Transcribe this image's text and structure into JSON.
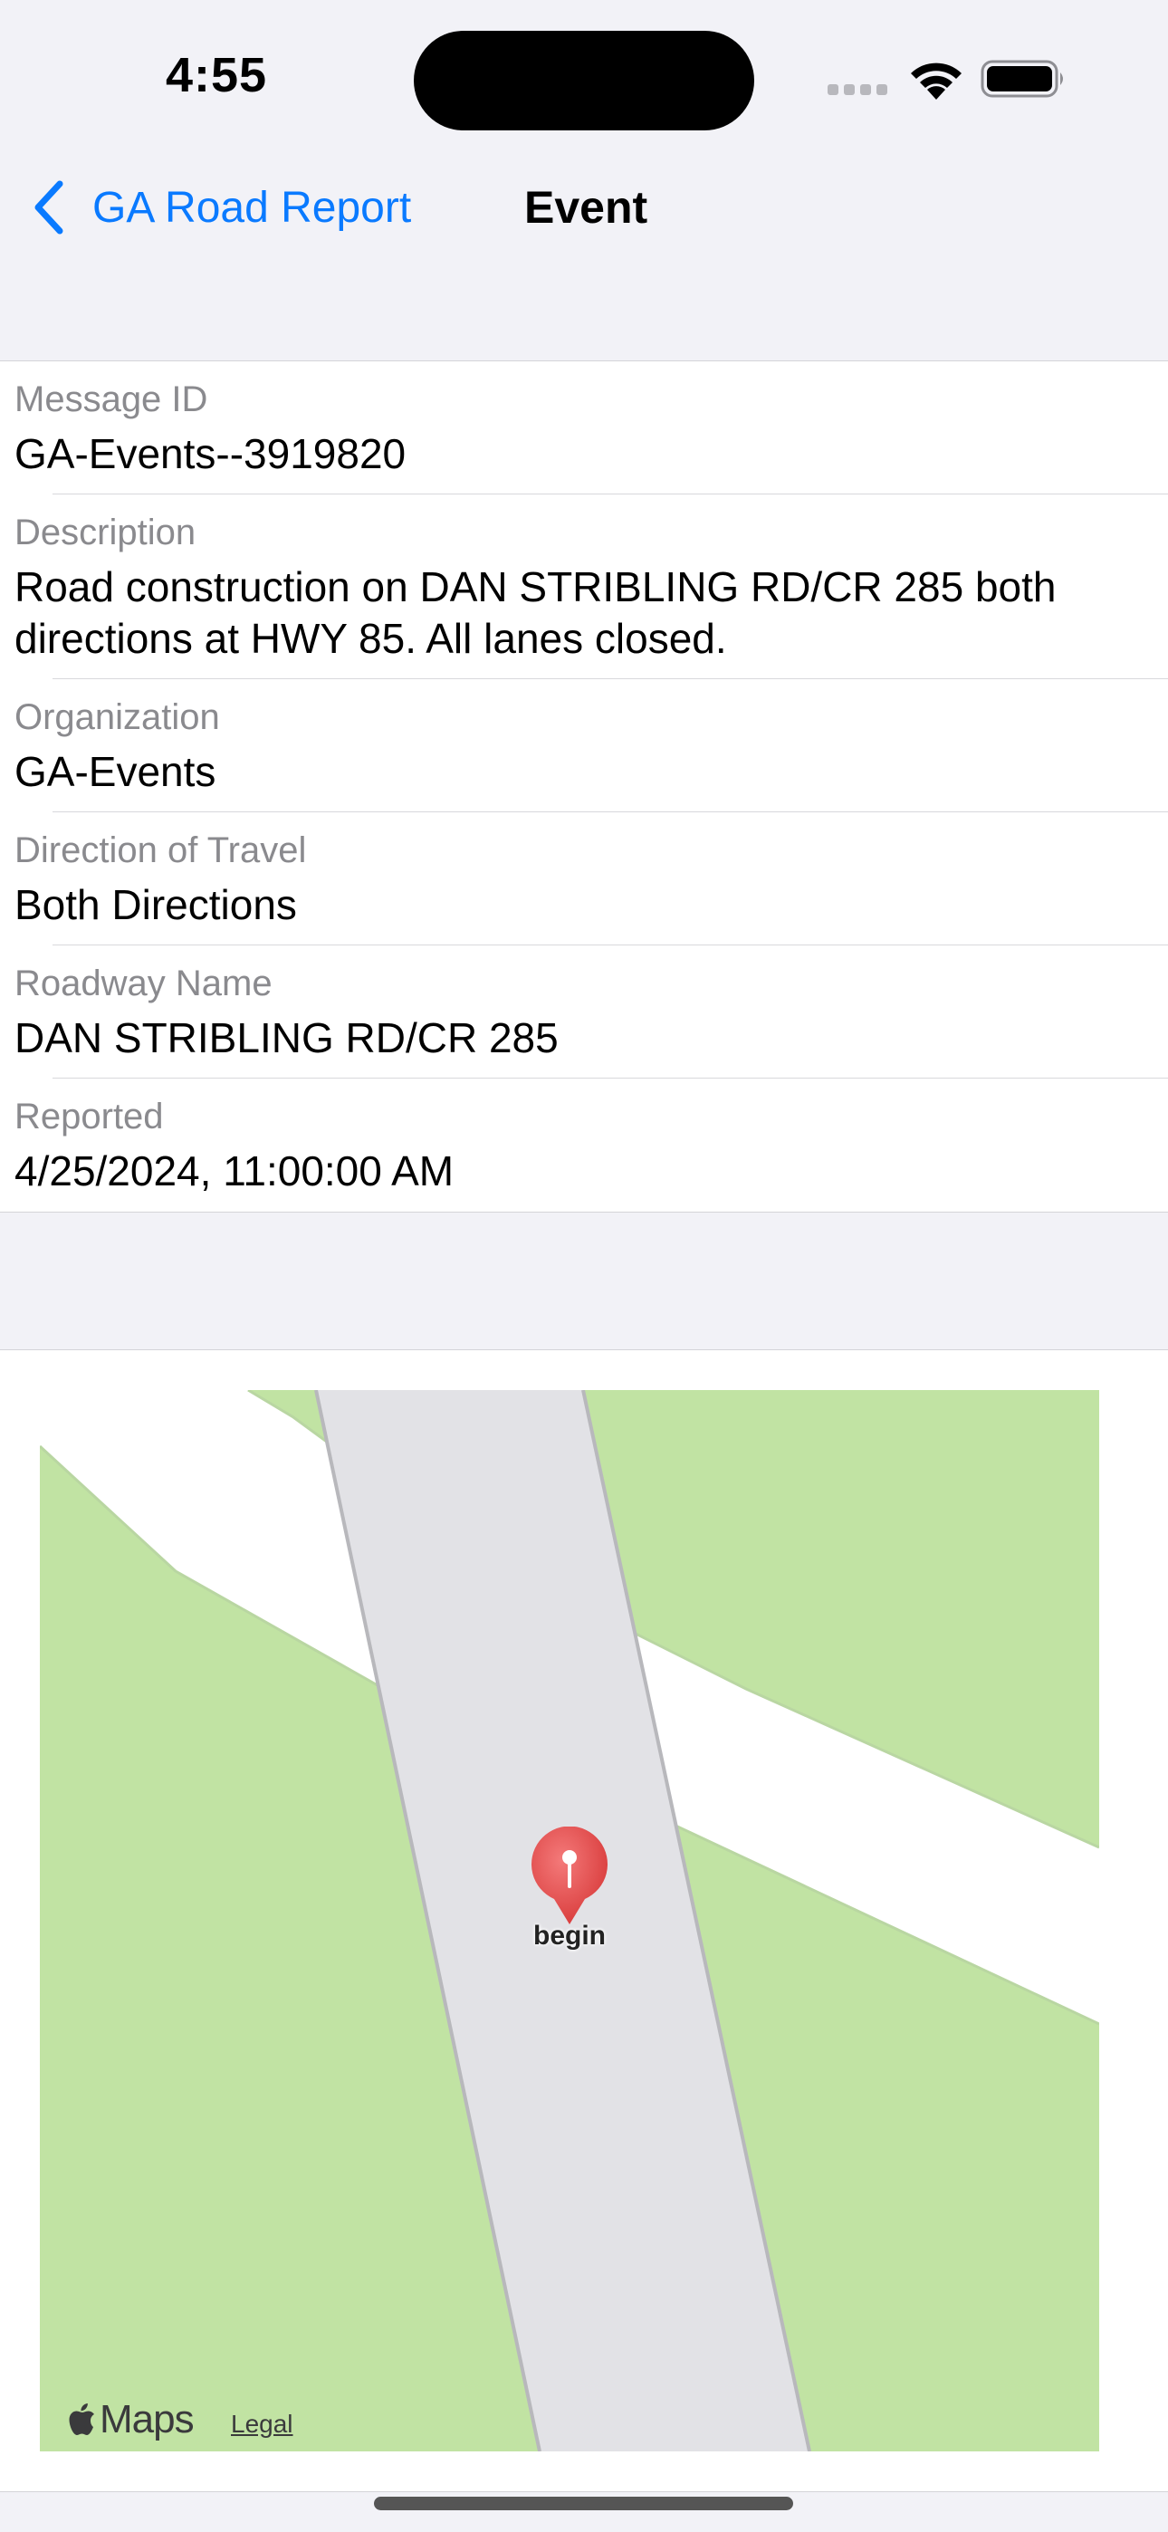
{
  "status_bar": {
    "time": "4:55"
  },
  "nav": {
    "back_label": "GA Road Report",
    "title": "Event"
  },
  "fields": [
    {
      "label": "Message ID",
      "value": "GA-Events--3919820"
    },
    {
      "label": "Description",
      "value": "Road construction on DAN STRIBLING RD/CR 285 both directions at HWY 85. All lanes closed."
    },
    {
      "label": "Organization",
      "value": "GA-Events"
    },
    {
      "label": "Direction of Travel",
      "value": "Both Directions"
    },
    {
      "label": "Roadway Name",
      "value": "DAN STRIBLING RD/CR 285"
    },
    {
      "label": "Reported",
      "value": "4/25/2024, 11:00:00 AM"
    }
  ],
  "map": {
    "pin_label": "begin",
    "brand_label": "Maps",
    "legal_label": "Legal"
  },
  "colors": {
    "accent": "#0a7aff",
    "pin": "#e84545",
    "grass": "#c1e3a3",
    "road": "#e2e2e6"
  }
}
